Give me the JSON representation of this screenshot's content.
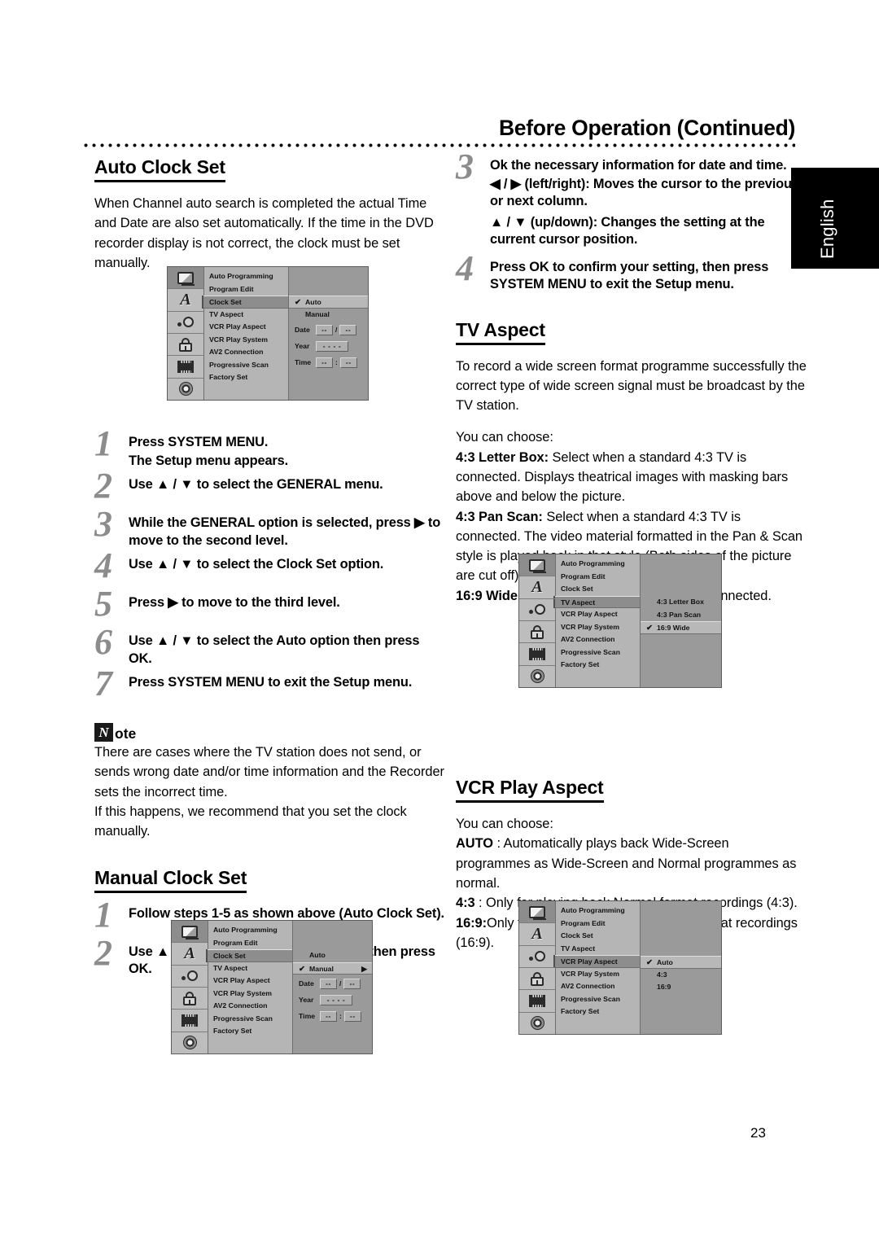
{
  "page": {
    "header_title": "Before Operation (Continued)",
    "side_tab": "English",
    "page_number": "23"
  },
  "left_column": {
    "auto_clock_set": {
      "heading": "Auto Clock Set",
      "intro": "When Channel auto search is completed the actual Time and Date are also set automatically. If the time in the DVD recorder display is not correct, the clock must be set manually.",
      "steps": [
        {
          "num": "1",
          "bold": "Press SYSTEM MENU.",
          "sub": "The Setup menu appears."
        },
        {
          "num": "2",
          "bold": "Use ▲ / ▼ to select the GENERAL menu.",
          "sub": ""
        },
        {
          "num": "3",
          "bold": "While the GENERAL option is selected, press ▶ to move to the second level.",
          "sub": ""
        },
        {
          "num": "4",
          "bold": "Use ▲ / ▼ to select the Clock Set option.",
          "sub": ""
        },
        {
          "num": "5",
          "bold": "Press ▶ to move to the third level.",
          "sub": ""
        },
        {
          "num": "6",
          "bold": "Use ▲ / ▼ to select the Auto option then press OK.",
          "sub": ""
        },
        {
          "num": "7",
          "bold": "Press SYSTEM MENU to exit the Setup menu.",
          "sub": ""
        }
      ]
    },
    "note": {
      "badge": "N",
      "word": "ote",
      "text_1": "There are cases where the TV station does not send, or sends wrong date and/or time information and the Recorder sets the incorrect time.",
      "text_2": "If this happens, we recommend that you set the clock manually."
    },
    "manual_clock_set": {
      "heading": "Manual Clock Set",
      "steps": [
        {
          "num": "1",
          "bold": "Follow steps 1-5 as shown above (Auto Clock Set).",
          "sub": ""
        },
        {
          "num": "2",
          "bold": "Use ▲ / ▼ to select the Manual option then press OK.",
          "sub": ""
        }
      ]
    }
  },
  "right_column": {
    "steps_continued": [
      {
        "num": "3",
        "bold": "Ok the necessary information for date and time.",
        "lines": [
          "◀ / ▶ (left/right): Moves the cursor to the previous or next column.",
          "▲ / ▼ (up/down): Changes the setting at the current cursor position."
        ]
      },
      {
        "num": "4",
        "bold": "Press OK to confirm your setting, then press SYSTEM MENU to exit the Setup menu.",
        "lines": []
      }
    ],
    "tv_aspect": {
      "heading": "TV Aspect",
      "intro": "To record a wide screen format programme successfully the correct type of wide screen signal must be broadcast by the TV station.",
      "choose_label": "You can choose:",
      "options": [
        {
          "term": "4:3 Letter Box:",
          "desc": " Select when a standard 4:3 TV is connected. Displays theatrical images with masking bars above and below the picture."
        },
        {
          "term": "4:3 Pan Scan:",
          "desc": " Select when a standard 4:3 TV is connected. The video material formatted in the Pan & Scan style is played back in that style (Both sides of the picture are cut off)."
        },
        {
          "term": "16:9 Wide:",
          "desc": " Select when a 16:9 wide TV is connected."
        }
      ]
    },
    "vcr_play_aspect": {
      "heading": "VCR Play Aspect",
      "choose_label": "You can choose:",
      "options": [
        {
          "term": "AUTO",
          "desc": " : Automatically plays back Wide-Screen programmes as Wide-Screen and Normal programmes as normal."
        },
        {
          "term": "4:3",
          "desc": " : Only for playing back Normal format recordings (4:3)."
        },
        {
          "term": "16:9:",
          "desc": "Only for playing back Wide-Screen format recordings (16:9)."
        }
      ]
    }
  },
  "osd_menus": {
    "icons": [
      "tv-icon",
      "language-icon",
      "audio-icon",
      "lock-icon",
      "film-icon",
      "disc-icon"
    ],
    "list_items": [
      "Auto Programming",
      "Program Edit",
      "Clock Set",
      "TV Aspect",
      "VCR Play Aspect",
      "VCR Play System",
      "AV2 Connection",
      "Progressive Scan",
      "Factory Set"
    ],
    "clock_auto": {
      "selected_list_item": "Clock Set",
      "options": [
        {
          "label": "Auto",
          "checked": true,
          "selected": true,
          "arrow": false
        },
        {
          "label": "Manual",
          "checked": false,
          "selected": false,
          "arrow": false
        }
      ],
      "fields": [
        {
          "label": "Date",
          "boxes": [
            "--",
            "--"
          ],
          "separator": "/"
        },
        {
          "label": "Year",
          "boxes": [
            "- - - -"
          ],
          "separator": ""
        },
        {
          "label": "Time",
          "boxes": [
            "--",
            "--"
          ],
          "separator": ":"
        }
      ]
    },
    "clock_manual": {
      "selected_list_item": "Clock Set",
      "options": [
        {
          "label": "Auto",
          "checked": false,
          "selected": false,
          "arrow": false
        },
        {
          "label": "Manual",
          "checked": true,
          "selected": true,
          "arrow": true
        }
      ],
      "fields": [
        {
          "label": "Date",
          "boxes": [
            "--",
            "--"
          ],
          "separator": "/"
        },
        {
          "label": "Year",
          "boxes": [
            "- - - -"
          ],
          "separator": ""
        },
        {
          "label": "Time",
          "boxes": [
            "--",
            "--"
          ],
          "separator": ":"
        }
      ]
    },
    "tv_aspect": {
      "selected_list_item": "TV Aspect",
      "options": [
        {
          "label": "4:3 Letter Box",
          "checked": false,
          "selected": false
        },
        {
          "label": "4:3 Pan Scan",
          "checked": false,
          "selected": false
        },
        {
          "label": "16:9 Wide",
          "checked": true,
          "selected": true
        }
      ]
    },
    "vcr_play_aspect": {
      "selected_list_item": "VCR Play Aspect",
      "options": [
        {
          "label": "Auto",
          "checked": true,
          "selected": true
        },
        {
          "label": "4:3",
          "checked": false,
          "selected": false
        },
        {
          "label": "16:9",
          "checked": false,
          "selected": false
        }
      ]
    }
  },
  "colors": {
    "page_bg": "#ffffff",
    "text": "#000000",
    "step_number": "#8c8c8c",
    "tab_bg": "#000000",
    "tab_text": "#ffffff",
    "osd_panel": "#9a9a9a",
    "osd_list": "#b5b5b5",
    "osd_selected": "#8d8d8d"
  }
}
